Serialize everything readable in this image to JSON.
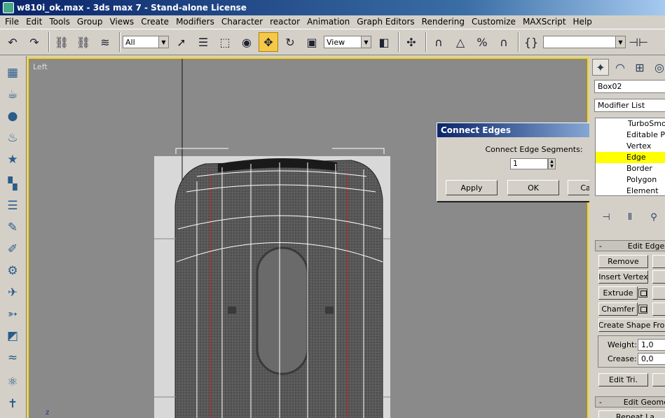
{
  "window": {
    "title": "w810i_ok.max - 3ds max 7 - Stand-alone License"
  },
  "menu": [
    "File",
    "Edit",
    "Tools",
    "Group",
    "Views",
    "Create",
    "Modifiers",
    "Character",
    "reactor",
    "Animation",
    "Graph Editors",
    "Rendering",
    "Customize",
    "MAXScript",
    "Help"
  ],
  "toolbar": {
    "selection_filter": "All",
    "reference_coord": "View",
    "named_selection": ""
  },
  "viewport": {
    "label": "Left",
    "axis_label": "z"
  },
  "command_panel": {
    "object_name": "Box02",
    "modifier_list": "Modifier List",
    "stack": [
      "TurboSmooth",
      "Editable Poly",
      "Vertex",
      "Edge",
      "Border",
      "Polygon",
      "Element"
    ],
    "stack_selected_index": 3,
    "edit_edges": {
      "title": "Edit Edges",
      "remove": "Remove",
      "insert_vertex": "Insert Vertex",
      "extrude": "Extrude",
      "chamfer": "Chamfer",
      "create_shape": "Create Shape From",
      "weight_label": "Weight:",
      "weight_value": "1,0",
      "crease_label": "Crease:",
      "crease_value": "0,0",
      "edit_tri": "Edit Tri."
    },
    "edit_geometry": {
      "title": "Edit Geome",
      "repeat_last": "Repeat La"
    }
  },
  "dialog": {
    "title": "Connect Edges",
    "label": "Connect Edge Segments:",
    "segments_value": "1",
    "apply": "Apply",
    "ok": "OK",
    "cancel": "Cancel"
  },
  "colors": {
    "viewport_border": "#ffd700",
    "selection_highlight": "#ffff00",
    "title_blue": "#0a246a"
  }
}
